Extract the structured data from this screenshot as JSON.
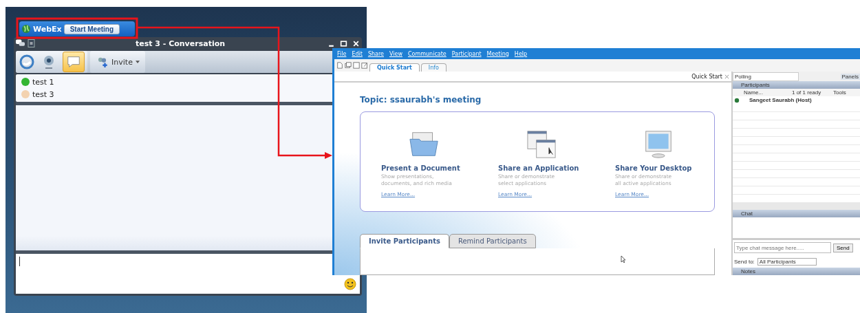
{
  "webex_bar": {
    "brand": "WebEx",
    "button": "Start Meeting"
  },
  "conversation": {
    "title": "test 3 - Conversation",
    "invite": "Invite",
    "contacts": [
      {
        "name": "test 1",
        "color": "#33b533"
      },
      {
        "name": "test 3",
        "color": "#f3d2b0"
      }
    ]
  },
  "meeting": {
    "menu": [
      "File",
      "Edit",
      "Share",
      "View",
      "Communicate",
      "Participant",
      "Meeting",
      "Help"
    ],
    "tabs": [
      {
        "label": "Quick Start",
        "selected": true
      },
      {
        "label": "Info",
        "selected": false
      }
    ],
    "panel_tab": "Quick Start",
    "topic": "Topic: ssaurabh's meeting",
    "actions": [
      {
        "kind": "document",
        "title": "Present a Document",
        "description": [
          "Show presentations,",
          "documents, and rich media"
        ],
        "link": "Learn More..."
      },
      {
        "kind": "application",
        "title": "Share an Application",
        "description": [
          "Share or demonstrate",
          "select applications"
        ],
        "link": "Learn More..."
      },
      {
        "kind": "desktop",
        "title": "Share Your Desktop",
        "description": [
          "Share or demonstrate",
          "all active applications"
        ],
        "link": "Learn More..."
      }
    ],
    "invite_tabs": [
      {
        "label": "Invite Participants",
        "selected": true
      },
      {
        "label": "Remind Participants",
        "selected": false
      }
    ],
    "side": {
      "polling": "Polling",
      "panels": "Panels",
      "participants": {
        "title": "Participants",
        "columns": [
          "Name...",
          "1 of 1 ready",
          "Tools"
        ],
        "rows": [
          {
            "name": "Sangeet Saurabh (Host)"
          }
        ]
      },
      "chat": {
        "title": "Chat",
        "placeholder": "Type chat message here.....",
        "send": "Send",
        "send_to_label": "Send to:",
        "send_to": "All Participants"
      },
      "notes": {
        "title": "Notes"
      }
    }
  }
}
